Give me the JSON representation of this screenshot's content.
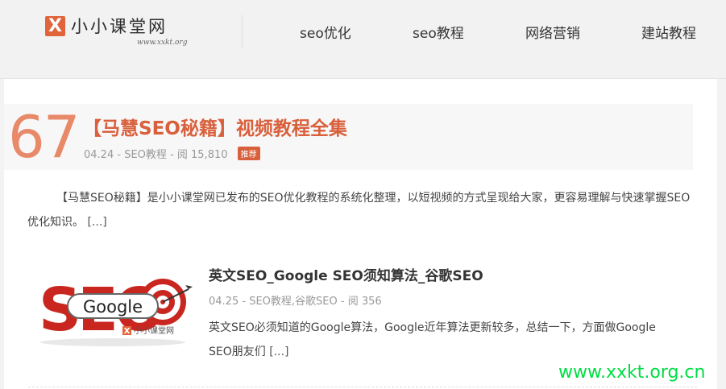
{
  "logo": {
    "mark": "X",
    "text": "小小课堂网",
    "sub": "www.xxkt.org"
  },
  "nav": [
    {
      "label": "seo优化"
    },
    {
      "label": "seo教程"
    },
    {
      "label": "网络营销"
    },
    {
      "label": "建站教程"
    }
  ],
  "featured": {
    "number": "67",
    "title": "【马慧SEO秘籍】视频教程全集",
    "date": "04.24",
    "category": "SEO教程",
    "views_label": "阅",
    "views": "15,810",
    "badge": "推荐",
    "excerpt": "【马慧SEO秘籍】是小小课堂网已发布的SEO优化教程的系统化整理，以短视频的方式呈现给大家，更容易理解与快速掌握SEO优化知识。",
    "more": "[...]"
  },
  "post": {
    "thumb_text": "SEO",
    "thumb_overlay": "Google",
    "thumb_brand": "小小课堂网",
    "title": "英文SEO_Google SEO须知算法_谷歌SEO",
    "date": "04.25",
    "category": "SEO教程,谷歌SEO",
    "views_label": "阅",
    "views": "356",
    "excerpt": "英文SEO必须知道的Google算法，Google近年算法更新较多，总结一下，方面做Google SEO朋友们",
    "more": "[...]"
  },
  "watermark": "www.xxkt.org.cn",
  "colors": {
    "accent": "#d9603c",
    "number": "#e8896a",
    "watermark": "#00dd44"
  }
}
